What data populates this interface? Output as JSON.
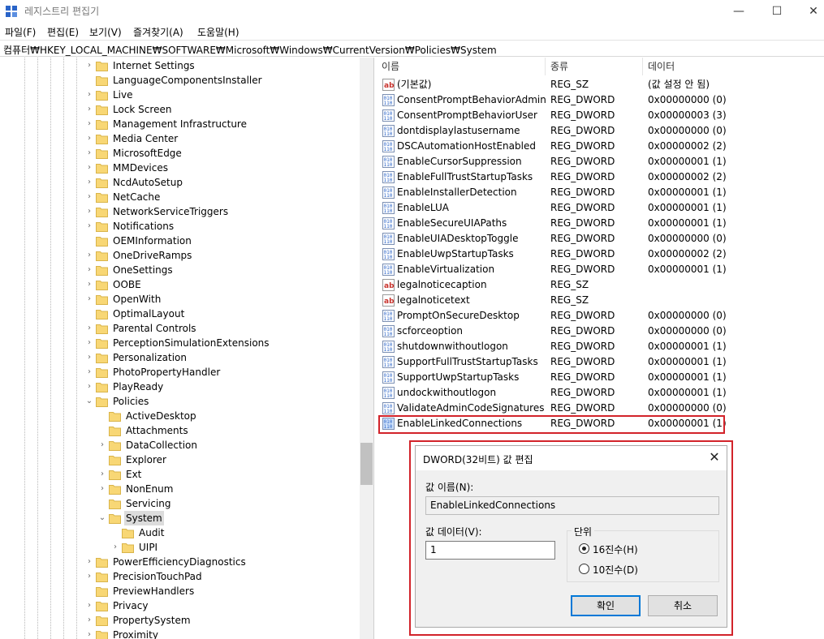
{
  "window": {
    "title": "레지스트리 편집기",
    "minimize": "—",
    "maximize": "☐",
    "close": "✕"
  },
  "menu": [
    "파일(F)",
    "편집(E)",
    "보기(V)",
    "즐겨찾기(A)",
    "도움말(H)"
  ],
  "address": "컴퓨터₩HKEY_LOCAL_MACHINE₩SOFTWARE₩Microsoft₩Windows₩CurrentVersion₩Policies₩System",
  "tree": [
    {
      "label": "Internet Settings",
      "level": 0,
      "expand": ">"
    },
    {
      "label": "LanguageComponentsInstaller",
      "level": 0,
      "expand": ""
    },
    {
      "label": "Live",
      "level": 0,
      "expand": ">"
    },
    {
      "label": "Lock Screen",
      "level": 0,
      "expand": ">"
    },
    {
      "label": "Management Infrastructure",
      "level": 0,
      "expand": ">"
    },
    {
      "label": "Media Center",
      "level": 0,
      "expand": ">"
    },
    {
      "label": "MicrosoftEdge",
      "level": 0,
      "expand": ">"
    },
    {
      "label": "MMDevices",
      "level": 0,
      "expand": ">"
    },
    {
      "label": "NcdAutoSetup",
      "level": 0,
      "expand": ">"
    },
    {
      "label": "NetCache",
      "level": 0,
      "expand": ">"
    },
    {
      "label": "NetworkServiceTriggers",
      "level": 0,
      "expand": ">"
    },
    {
      "label": "Notifications",
      "level": 0,
      "expand": ">"
    },
    {
      "label": "OEMInformation",
      "level": 0,
      "expand": ""
    },
    {
      "label": "OneDriveRamps",
      "level": 0,
      "expand": ">"
    },
    {
      "label": "OneSettings",
      "level": 0,
      "expand": ">"
    },
    {
      "label": "OOBE",
      "level": 0,
      "expand": ">"
    },
    {
      "label": "OpenWith",
      "level": 0,
      "expand": ">"
    },
    {
      "label": "OptimalLayout",
      "level": 0,
      "expand": ""
    },
    {
      "label": "Parental Controls",
      "level": 0,
      "expand": ">"
    },
    {
      "label": "PerceptionSimulationExtensions",
      "level": 0,
      "expand": ">"
    },
    {
      "label": "Personalization",
      "level": 0,
      "expand": ">"
    },
    {
      "label": "PhotoPropertyHandler",
      "level": 0,
      "expand": ">"
    },
    {
      "label": "PlayReady",
      "level": 0,
      "expand": ">"
    },
    {
      "label": "Policies",
      "level": 0,
      "expand": "v"
    },
    {
      "label": "ActiveDesktop",
      "level": 1,
      "expand": ""
    },
    {
      "label": "Attachments",
      "level": 1,
      "expand": ""
    },
    {
      "label": "DataCollection",
      "level": 1,
      "expand": ">"
    },
    {
      "label": "Explorer",
      "level": 1,
      "expand": ""
    },
    {
      "label": "Ext",
      "level": 1,
      "expand": ">"
    },
    {
      "label": "NonEnum",
      "level": 1,
      "expand": ">"
    },
    {
      "label": "Servicing",
      "level": 1,
      "expand": ""
    },
    {
      "label": "System",
      "level": 1,
      "expand": "v",
      "selected": true
    },
    {
      "label": "Audit",
      "level": 2,
      "expand": ""
    },
    {
      "label": "UIPI",
      "level": 2,
      "expand": ">"
    },
    {
      "label": "PowerEfficiencyDiagnostics",
      "level": 0,
      "expand": ">"
    },
    {
      "label": "PrecisionTouchPad",
      "level": 0,
      "expand": ">"
    },
    {
      "label": "PreviewHandlers",
      "level": 0,
      "expand": ""
    },
    {
      "label": "Privacy",
      "level": 0,
      "expand": ">"
    },
    {
      "label": "PropertySystem",
      "level": 0,
      "expand": ">"
    },
    {
      "label": "Proximity",
      "level": 0,
      "expand": ">"
    }
  ],
  "columns": [
    "이름",
    "종류",
    "데이터"
  ],
  "values": [
    {
      "icon": "string",
      "name": "(기본값)",
      "type": "REG_SZ",
      "data": "(값 설정 안 됨)"
    },
    {
      "icon": "binary",
      "name": "ConsentPromptBehaviorAdmin",
      "type": "REG_DWORD",
      "data": "0x00000000 (0)"
    },
    {
      "icon": "binary",
      "name": "ConsentPromptBehaviorUser",
      "type": "REG_DWORD",
      "data": "0x00000003 (3)"
    },
    {
      "icon": "binary",
      "name": "dontdisplaylastusername",
      "type": "REG_DWORD",
      "data": "0x00000000 (0)"
    },
    {
      "icon": "binary",
      "name": "DSCAutomationHostEnabled",
      "type": "REG_DWORD",
      "data": "0x00000002 (2)"
    },
    {
      "icon": "binary",
      "name": "EnableCursorSuppression",
      "type": "REG_DWORD",
      "data": "0x00000001 (1)"
    },
    {
      "icon": "binary",
      "name": "EnableFullTrustStartupTasks",
      "type": "REG_DWORD",
      "data": "0x00000002 (2)"
    },
    {
      "icon": "binary",
      "name": "EnableInstallerDetection",
      "type": "REG_DWORD",
      "data": "0x00000001 (1)"
    },
    {
      "icon": "binary",
      "name": "EnableLUA",
      "type": "REG_DWORD",
      "data": "0x00000001 (1)"
    },
    {
      "icon": "binary",
      "name": "EnableSecureUIAPaths",
      "type": "REG_DWORD",
      "data": "0x00000001 (1)"
    },
    {
      "icon": "binary",
      "name": "EnableUIADesktopToggle",
      "type": "REG_DWORD",
      "data": "0x00000000 (0)"
    },
    {
      "icon": "binary",
      "name": "EnableUwpStartupTasks",
      "type": "REG_DWORD",
      "data": "0x00000002 (2)"
    },
    {
      "icon": "binary",
      "name": "EnableVirtualization",
      "type": "REG_DWORD",
      "data": "0x00000001 (1)"
    },
    {
      "icon": "string",
      "name": "legalnoticecaption",
      "type": "REG_SZ",
      "data": ""
    },
    {
      "icon": "string",
      "name": "legalnoticetext",
      "type": "REG_SZ",
      "data": ""
    },
    {
      "icon": "binary",
      "name": "PromptOnSecureDesktop",
      "type": "REG_DWORD",
      "data": "0x00000000 (0)"
    },
    {
      "icon": "binary",
      "name": "scforceoption",
      "type": "REG_DWORD",
      "data": "0x00000000 (0)"
    },
    {
      "icon": "binary",
      "name": "shutdownwithoutlogon",
      "type": "REG_DWORD",
      "data": "0x00000001 (1)"
    },
    {
      "icon": "binary",
      "name": "SupportFullTrustStartupTasks",
      "type": "REG_DWORD",
      "data": "0x00000001 (1)"
    },
    {
      "icon": "binary",
      "name": "SupportUwpStartupTasks",
      "type": "REG_DWORD",
      "data": "0x00000001 (1)"
    },
    {
      "icon": "binary",
      "name": "undockwithoutlogon",
      "type": "REG_DWORD",
      "data": "0x00000001 (1)"
    },
    {
      "icon": "binary",
      "name": "ValidateAdminCodeSignatures",
      "type": "REG_DWORD",
      "data": "0x00000000 (0)"
    },
    {
      "icon": "binary",
      "name": "EnableLinkedConnections",
      "type": "REG_DWORD",
      "data": "0x00000001 (1)",
      "highlighted": true
    }
  ],
  "dialog": {
    "title": "DWORD(32비트) 값 편집",
    "close": "✕",
    "name_label": "값 이름(N):",
    "name_value": "EnableLinkedConnections",
    "data_label": "값 데이터(V):",
    "data_value": "1",
    "base_label": "단위",
    "hex_label": "16진수(H)",
    "dec_label": "10진수(D)",
    "base_selected": "hex",
    "ok": "확인",
    "cancel": "취소"
  },
  "colors": {
    "highlight": "#d2232a",
    "default_button": "#0078d7",
    "folder": "#f8d775",
    "icon_blue": "#2a64c8"
  }
}
